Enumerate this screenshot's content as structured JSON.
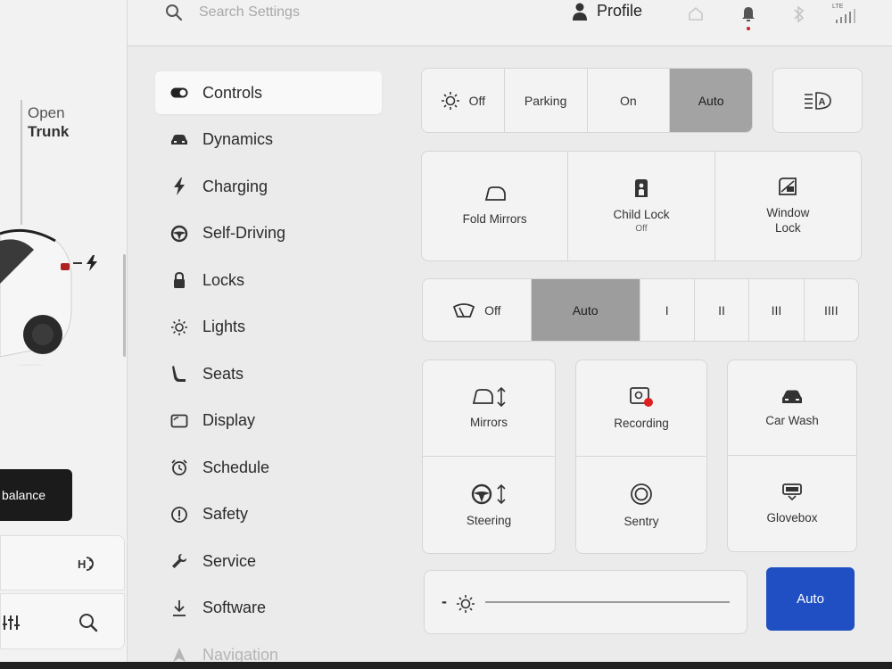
{
  "car_panel": {
    "trunk_open": "Open",
    "trunk_name": "Trunk",
    "balance_label": "balance"
  },
  "topbar": {
    "search_placeholder": "Search Settings",
    "profile_label": "Profile",
    "network_label": "LTE"
  },
  "menu": {
    "items": [
      {
        "label": "Controls",
        "icon": "toggle-icon"
      },
      {
        "label": "Dynamics",
        "icon": "car-icon"
      },
      {
        "label": "Charging",
        "icon": "lightning-icon"
      },
      {
        "label": "Self-Driving",
        "icon": "steering-wheel-icon"
      },
      {
        "label": "Locks",
        "icon": "lock-icon"
      },
      {
        "label": "Lights",
        "icon": "sun-icon"
      },
      {
        "label": "Seats",
        "icon": "seat-icon"
      },
      {
        "label": "Display",
        "icon": "display-icon"
      },
      {
        "label": "Schedule",
        "icon": "alarm-clock-icon"
      },
      {
        "label": "Safety",
        "icon": "alert-circle-icon"
      },
      {
        "label": "Service",
        "icon": "wrench-icon"
      },
      {
        "label": "Software",
        "icon": "download-icon"
      },
      {
        "label": "Navigation",
        "icon": "navigation-arrow-icon"
      }
    ],
    "active": "Controls"
  },
  "headlights": {
    "options": [
      "Off",
      "Parking",
      "On",
      "Auto"
    ],
    "selected": "Auto"
  },
  "quick_tiles": {
    "fold_mirrors": "Fold Mirrors",
    "child_lock": "Child Lock",
    "child_lock_state": "Off",
    "window_lock_line1": "Window",
    "window_lock_line2": "Lock"
  },
  "wipers": {
    "options": [
      "Off",
      "Auto",
      "I",
      "II",
      "III",
      "IIII"
    ],
    "selected": "Auto"
  },
  "controls": {
    "mirrors": "Mirrors",
    "steering": "Steering",
    "recording": "Recording",
    "sentry": "Sentry",
    "car_wash": "Car Wash",
    "glovebox": "Glovebox"
  },
  "brightness": {
    "minus": "-",
    "auto_label": "Auto"
  },
  "colors": {
    "accent": "#1f4fc2",
    "selected_segment": "#a3a3a3",
    "record_dot": "#e02020",
    "notification_dot": "#c62828"
  }
}
